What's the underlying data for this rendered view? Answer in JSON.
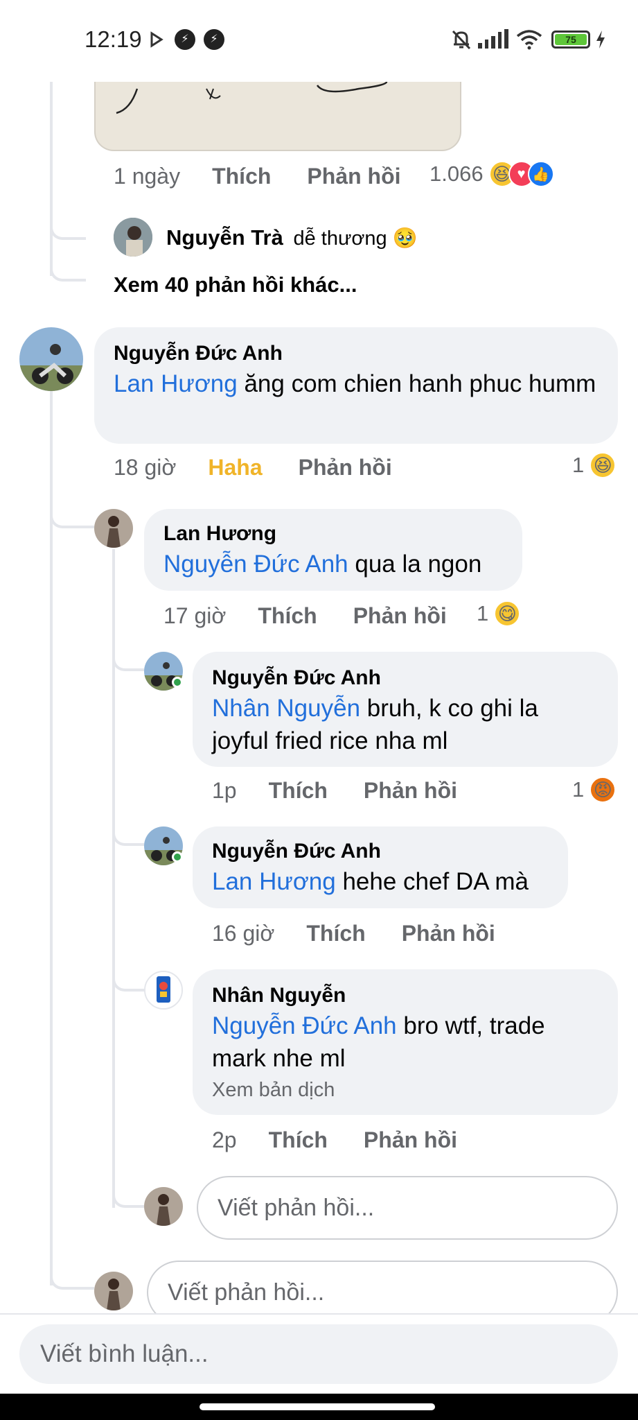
{
  "status_bar": {
    "time": "12:19",
    "battery": "75"
  },
  "top_comment": {
    "time": "1 ngày",
    "like": "Thích",
    "reply": "Phản hồi",
    "reaction_count": "1.066"
  },
  "preview_reply": {
    "name": "Nguyễn Trà",
    "text": "dễ thương 🥹"
  },
  "more_replies": "Xem 40 phản hồi khác...",
  "comments": [
    {
      "name": "Nguyễn Đức Anh",
      "mention": "Lan Hương",
      "text": "ăng com chien hanh phuc humm",
      "time": "18 giờ",
      "like": "Haha",
      "reply": "Phản hồi",
      "reaction_count": "1"
    },
    {
      "name": "Lan Hương",
      "mention": "Nguyễn Đức Anh",
      "text": "qua la ngon",
      "time": "17 giờ",
      "like": "Thích",
      "reply": "Phản hồi",
      "reaction_count": "1"
    },
    {
      "name": "Nguyễn Đức Anh",
      "mention": "Nhân Nguyễn",
      "text": "bruh, k co ghi la joyful fried rice nha ml",
      "time": "1p",
      "like": "Thích",
      "reply": "Phản hồi",
      "reaction_count": "1"
    },
    {
      "name": "Nguyễn Đức Anh",
      "mention": "Lan Hương",
      "text": "hehe chef DA mà",
      "time": "16 giờ",
      "like": "Thích",
      "reply": "Phản hồi"
    },
    {
      "name": "Nhân Nguyễn",
      "mention": "Nguyễn Đức Anh",
      "text": "bro wtf, trade mark nhe ml",
      "translate": "Xem bản dịch",
      "time": "2p",
      "like": "Thích",
      "reply": "Phản hồi"
    }
  ],
  "reply_placeholder": "Viết phản hồi...",
  "comment_placeholder": "Viết bình luận...",
  "colors": {
    "mention": "#216fdb",
    "haha": "#f0b429",
    "bubble": "#f0f2f5"
  }
}
